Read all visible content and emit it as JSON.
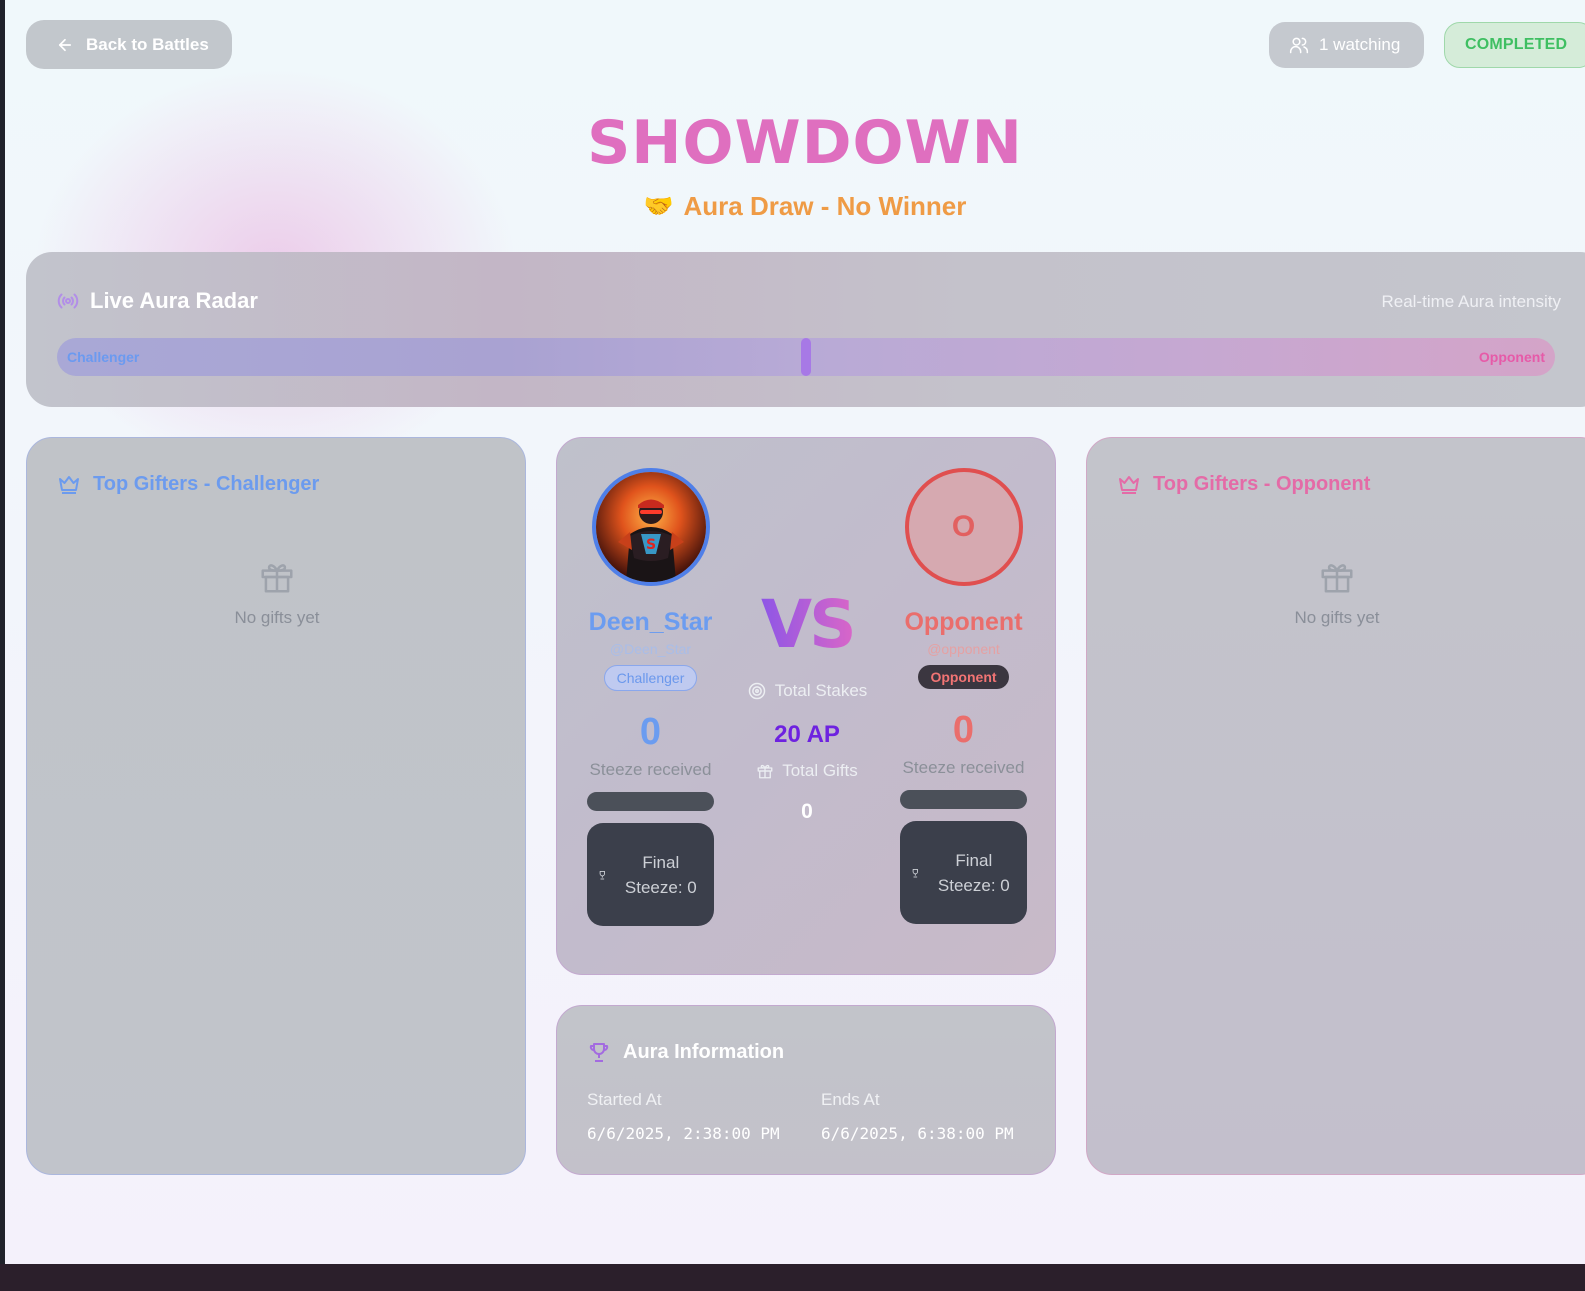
{
  "header": {
    "back_label": "Back to Battles",
    "watching_label": "1 watching",
    "status_label": "COMPLETED"
  },
  "battle": {
    "title": "SHOWDOWN",
    "result_emoji": "🤝",
    "result_text": "Aura Draw - No Winner"
  },
  "radar": {
    "title": "Live Aura Radar",
    "subtitle": "Real-time Aura intensity",
    "left_label": "Challenger",
    "right_label": "Opponent",
    "position": 0.5
  },
  "gifters_left": {
    "title": "Top Gifters - Challenger",
    "empty_text": "No gifts yet"
  },
  "gifters_right": {
    "title": "Top Gifters - Opponent",
    "empty_text": "No gifts yet"
  },
  "challenger": {
    "name": "Deen_Star",
    "handle": "@Deen_Star",
    "role": "Challenger",
    "score": "0",
    "received_label": "Steeze received",
    "final_label": "Final Steeze: 0",
    "progress": 0
  },
  "opponent": {
    "initial": "O",
    "name": "Opponent",
    "handle": "@opponent",
    "role": "Opponent",
    "score": "0",
    "received_label": "Steeze received",
    "final_label": "Final Steeze: 0",
    "progress": 0
  },
  "center": {
    "vs": "VS",
    "stakes_label": "Total Stakes",
    "stakes_value": "20 AP",
    "gifts_label": "Total Gifts",
    "gifts_value": "0"
  },
  "info": {
    "title": "Aura Information",
    "started_label": "Started At",
    "started_value": "6/6/2025, 2:38:00 PM",
    "ends_label": "Ends At",
    "ends_value": "6/6/2025, 6:38:00 PM"
  },
  "colors": {
    "title": "#df6fbf",
    "result": "#ef9b45",
    "challenger": "#6b9cf0",
    "opponent": "#ea6e6c",
    "stakes": "#6e22e0",
    "status": "#3fbf62"
  }
}
